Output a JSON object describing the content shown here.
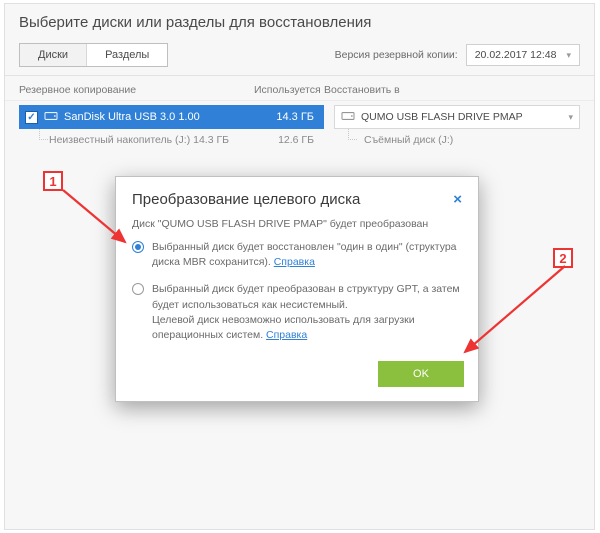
{
  "header": {
    "title": "Выберите диски или разделы для восстановления"
  },
  "tabs": {
    "disks": "Диски",
    "partitions": "Разделы"
  },
  "version": {
    "label": "Версия резервной копии:",
    "value": "20.02.2017 12:48"
  },
  "columns": {
    "backup": "Резервное копирование",
    "used": "Используется",
    "restore_to": "Восстановить в"
  },
  "source": {
    "drive_name": "SanDisk Ultra USB 3.0 1.00",
    "drive_size": "14.3 ГБ",
    "part_name": "Неизвестный накопитель (J:) 14.3 ГБ",
    "part_used": "12.6 ГБ"
  },
  "dest": {
    "drive_name": "QUMO USB FLASH DRIVE PMAP",
    "sub": "Съёмный диск (J:)"
  },
  "modal": {
    "title": "Преобразование целевого диска",
    "sub": "Диск \"QUMO USB FLASH DRIVE PMAP\" будет преобразован",
    "opt1_a": "Выбранный диск будет восстановлен \"один в один\" (структура диска MBR сохранится). ",
    "opt2_a": "Выбранный диск будет преобразован в структуру GPT, а затем будет использоваться как несистемный.",
    "opt2_b": "Целевой диск невозможно использовать для загрузки операционных систем. ",
    "help": "Справка",
    "ok": "OK"
  },
  "callouts": {
    "one": "1",
    "two": "2"
  }
}
